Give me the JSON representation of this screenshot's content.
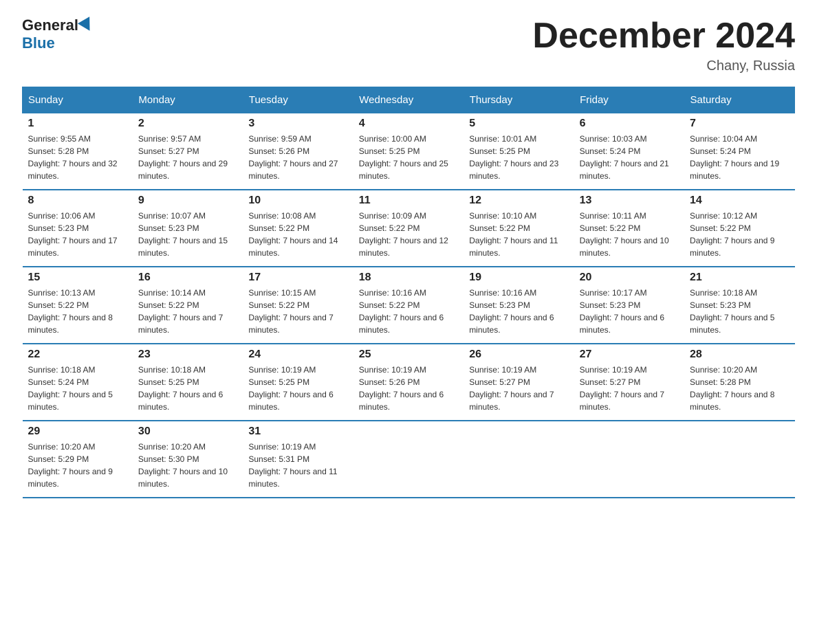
{
  "header": {
    "logo_general": "General",
    "logo_blue": "Blue",
    "month_title": "December 2024",
    "location": "Chany, Russia"
  },
  "weekdays": [
    "Sunday",
    "Monday",
    "Tuesday",
    "Wednesday",
    "Thursday",
    "Friday",
    "Saturday"
  ],
  "weeks": [
    [
      {
        "day": "1",
        "sunrise": "9:55 AM",
        "sunset": "5:28 PM",
        "daylight": "7 hours and 32 minutes."
      },
      {
        "day": "2",
        "sunrise": "9:57 AM",
        "sunset": "5:27 PM",
        "daylight": "7 hours and 29 minutes."
      },
      {
        "day": "3",
        "sunrise": "9:59 AM",
        "sunset": "5:26 PM",
        "daylight": "7 hours and 27 minutes."
      },
      {
        "day": "4",
        "sunrise": "10:00 AM",
        "sunset": "5:25 PM",
        "daylight": "7 hours and 25 minutes."
      },
      {
        "day": "5",
        "sunrise": "10:01 AM",
        "sunset": "5:25 PM",
        "daylight": "7 hours and 23 minutes."
      },
      {
        "day": "6",
        "sunrise": "10:03 AM",
        "sunset": "5:24 PM",
        "daylight": "7 hours and 21 minutes."
      },
      {
        "day": "7",
        "sunrise": "10:04 AM",
        "sunset": "5:24 PM",
        "daylight": "7 hours and 19 minutes."
      }
    ],
    [
      {
        "day": "8",
        "sunrise": "10:06 AM",
        "sunset": "5:23 PM",
        "daylight": "7 hours and 17 minutes."
      },
      {
        "day": "9",
        "sunrise": "10:07 AM",
        "sunset": "5:23 PM",
        "daylight": "7 hours and 15 minutes."
      },
      {
        "day": "10",
        "sunrise": "10:08 AM",
        "sunset": "5:22 PM",
        "daylight": "7 hours and 14 minutes."
      },
      {
        "day": "11",
        "sunrise": "10:09 AM",
        "sunset": "5:22 PM",
        "daylight": "7 hours and 12 minutes."
      },
      {
        "day": "12",
        "sunrise": "10:10 AM",
        "sunset": "5:22 PM",
        "daylight": "7 hours and 11 minutes."
      },
      {
        "day": "13",
        "sunrise": "10:11 AM",
        "sunset": "5:22 PM",
        "daylight": "7 hours and 10 minutes."
      },
      {
        "day": "14",
        "sunrise": "10:12 AM",
        "sunset": "5:22 PM",
        "daylight": "7 hours and 9 minutes."
      }
    ],
    [
      {
        "day": "15",
        "sunrise": "10:13 AM",
        "sunset": "5:22 PM",
        "daylight": "7 hours and 8 minutes."
      },
      {
        "day": "16",
        "sunrise": "10:14 AM",
        "sunset": "5:22 PM",
        "daylight": "7 hours and 7 minutes."
      },
      {
        "day": "17",
        "sunrise": "10:15 AM",
        "sunset": "5:22 PM",
        "daylight": "7 hours and 7 minutes."
      },
      {
        "day": "18",
        "sunrise": "10:16 AM",
        "sunset": "5:22 PM",
        "daylight": "7 hours and 6 minutes."
      },
      {
        "day": "19",
        "sunrise": "10:16 AM",
        "sunset": "5:23 PM",
        "daylight": "7 hours and 6 minutes."
      },
      {
        "day": "20",
        "sunrise": "10:17 AM",
        "sunset": "5:23 PM",
        "daylight": "7 hours and 6 minutes."
      },
      {
        "day": "21",
        "sunrise": "10:18 AM",
        "sunset": "5:23 PM",
        "daylight": "7 hours and 5 minutes."
      }
    ],
    [
      {
        "day": "22",
        "sunrise": "10:18 AM",
        "sunset": "5:24 PM",
        "daylight": "7 hours and 5 minutes."
      },
      {
        "day": "23",
        "sunrise": "10:18 AM",
        "sunset": "5:25 PM",
        "daylight": "7 hours and 6 minutes."
      },
      {
        "day": "24",
        "sunrise": "10:19 AM",
        "sunset": "5:25 PM",
        "daylight": "7 hours and 6 minutes."
      },
      {
        "day": "25",
        "sunrise": "10:19 AM",
        "sunset": "5:26 PM",
        "daylight": "7 hours and 6 minutes."
      },
      {
        "day": "26",
        "sunrise": "10:19 AM",
        "sunset": "5:27 PM",
        "daylight": "7 hours and 7 minutes."
      },
      {
        "day": "27",
        "sunrise": "10:19 AM",
        "sunset": "5:27 PM",
        "daylight": "7 hours and 7 minutes."
      },
      {
        "day": "28",
        "sunrise": "10:20 AM",
        "sunset": "5:28 PM",
        "daylight": "7 hours and 8 minutes."
      }
    ],
    [
      {
        "day": "29",
        "sunrise": "10:20 AM",
        "sunset": "5:29 PM",
        "daylight": "7 hours and 9 minutes."
      },
      {
        "day": "30",
        "sunrise": "10:20 AM",
        "sunset": "5:30 PM",
        "daylight": "7 hours and 10 minutes."
      },
      {
        "day": "31",
        "sunrise": "10:19 AM",
        "sunset": "5:31 PM",
        "daylight": "7 hours and 11 minutes."
      },
      null,
      null,
      null,
      null
    ]
  ]
}
